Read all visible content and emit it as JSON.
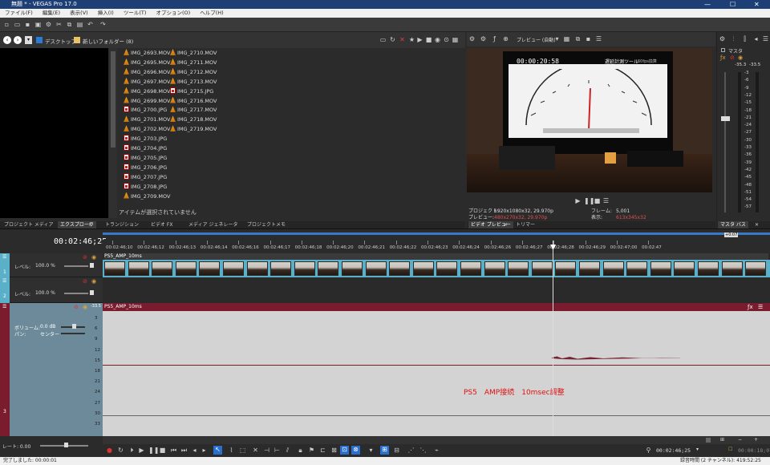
{
  "window": {
    "title": "無題 * - VEGAS Pro 17.0",
    "colors": {
      "titlebar": "#1e3f75",
      "accent": "#5ab0c8",
      "audio_header": "#7a1c2e",
      "annotation": "#e01010"
    }
  },
  "menu": [
    "ファイル(F)",
    "編集(E)",
    "表示(V)",
    "挿入(I)",
    "ツール(T)",
    "オプション(O)",
    "ヘルプ(H)"
  ],
  "explorer": {
    "path_items": [
      "デスクトップ",
      "新しいフォルダー (8)"
    ],
    "files_col1": [
      "IMG_2693.MOV",
      "IMG_2695.MOV",
      "IMG_2696.MOV",
      "IMG_2697.MOV",
      "IMG_2698.MOV",
      "IMG_2699.MOV",
      "IMG_2700.JPG",
      "IMG_2701.MOV",
      "IMG_2702.MOV",
      "IMG_2703.JPG",
      "IMG_2704.JPG",
      "IMG_2705.JPG",
      "IMG_2706.JPG",
      "IMG_2707.JPG",
      "IMG_2708.JPG",
      "IMG_2709.MOV"
    ],
    "files_col2": [
      "IMG_2710.MOV",
      "IMG_2711.MOV",
      "IMG_2712.MOV",
      "IMG_2713.MOV",
      "IMG_2715.JPG",
      "IMG_2716.MOV",
      "IMG_2717.MOV",
      "IMG_2718.MOV",
      "IMG_2719.MOV"
    ],
    "status": "アイテムが選択されていません"
  },
  "tabs_left": [
    "プロジェクト メディア",
    "エクスプローラ",
    "トランジション",
    "ビデオ FX",
    "メディア ジェネレータ",
    "プロジェクトメモ"
  ],
  "tabs_right": [
    "ビデオ プレビュー",
    "トリマー"
  ],
  "tabs_master": [
    "マスタ バス"
  ],
  "preview": {
    "mode": "プレビュー (自動)",
    "frame_timecode": "00:00:20:58",
    "frame_title": "遅延計測ツール",
    "frame_subtitle": "60fps換算",
    "project_label": "プロジェクト:",
    "project_value": "1920x1080x32, 29.970p",
    "preview_label": "プレビュー:",
    "preview_value": "480x270x32, 29.970p",
    "frame_label": "フレーム:",
    "frame_value": "5,001",
    "display_label": "表示:",
    "display_value": "613x345x32"
  },
  "master": {
    "label": "マスタ",
    "peak_left": "-35.3",
    "peak_right": "-33.5",
    "scale": [
      "3",
      "6",
      "9",
      "12",
      "15",
      "18",
      "21",
      "24",
      "27",
      "30",
      "33",
      "36",
      "39",
      "42",
      "45",
      "48",
      "51",
      "54",
      "57"
    ]
  },
  "timeline": {
    "timecode": "00:02:46;25",
    "ruler": [
      "00:02:46;10",
      "00:02:46;12",
      "00:02:46;13",
      "00:02:46;14",
      "00:02:46;16",
      "00:02:46;17",
      "00:02:46;18",
      "00:02:46;20",
      "00:02:46;21",
      "00:02:46;22",
      "00:02:46;23",
      "00:02:46;24",
      "00:02:46;26",
      "00:02:46;27",
      "00:02:46;28",
      "00:02:46;29",
      "00:02:47;00",
      "00:02:47"
    ],
    "track1": {
      "num": "1",
      "level_label": "レベル:",
      "level_value": "100.0 %"
    },
    "track2": {
      "num": "2",
      "level_label": "レベル:",
      "level_value": "100.0 %"
    },
    "audio": {
      "num": "3",
      "volume_label": "ボリューム:",
      "volume_value": "0.0 dB",
      "pan_label": "パン:",
      "pan_value": "センター",
      "meter_value": "-33.5"
    },
    "video_clip": "PS5_AMP_10ms",
    "audio_clip": "PS5_AMP_10ms",
    "db_scale": [
      "3",
      "6",
      "9",
      "12",
      "15",
      "18",
      "21",
      "24",
      "27",
      "30",
      "33"
    ],
    "annotation": "PS5　AMP接続　10msec調整",
    "rate_label": "レート: 0.00",
    "transport_time": "00:02:46;25",
    "transport_time2": "00:00:18;07"
  },
  "status": {
    "left": "完了しました: 00:00:01",
    "right": "録音時間 (2 チャンネル): 419:52:25"
  }
}
